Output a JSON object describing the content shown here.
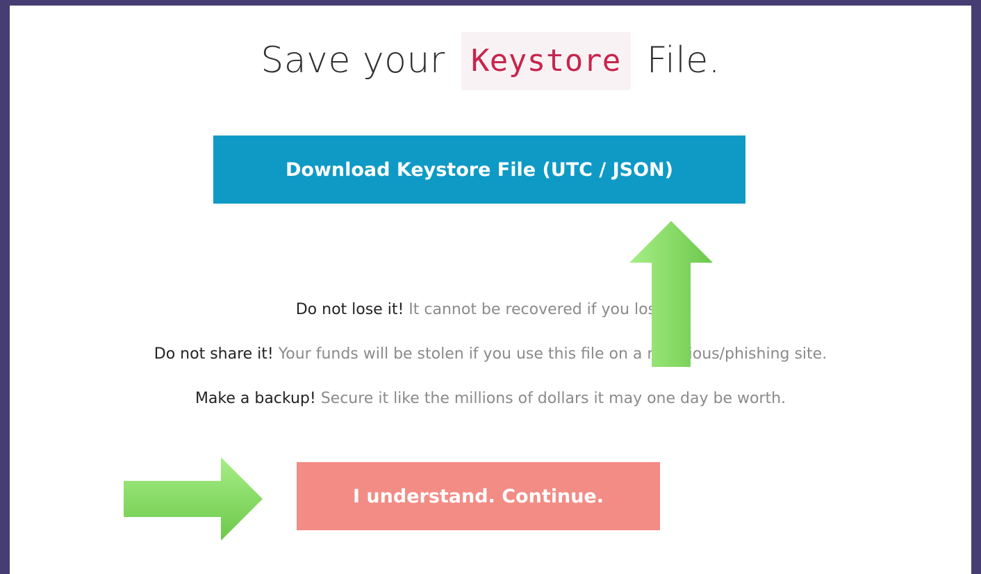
{
  "title": {
    "prefix": "Save your",
    "code": "Keystore",
    "suffix": "File."
  },
  "download_button": {
    "label": "Download Keystore File (UTC / JSON)",
    "color": "#0f9ac6"
  },
  "warnings": [
    {
      "strong": "Do not lose it!",
      "text": "It cannot be recovered if you lose it."
    },
    {
      "strong": "Do not share it!",
      "text": "Your funds will be stolen if you use this file on a malicious/phishing site."
    },
    {
      "strong": "Make a backup!",
      "text": "Secure it like the millions of dollars it may one day be worth."
    }
  ],
  "continue_button": {
    "label": "I understand. Continue.",
    "color": "#f28c85"
  },
  "annotations": {
    "up_arrow_icon": "arrow-up-icon",
    "right_arrow_icon": "arrow-right-icon",
    "arrow_color": "#7ed957"
  },
  "colors": {
    "frame_border": "#463d72",
    "code_text": "#c7254e",
    "code_background": "#f9f2f4"
  }
}
